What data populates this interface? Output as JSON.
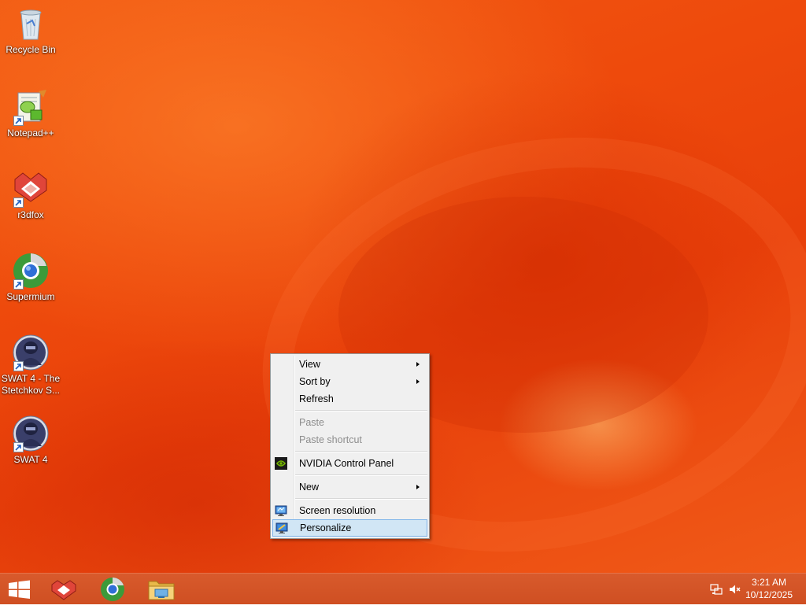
{
  "desktop": {
    "icons": [
      {
        "label": "Recycle Bin",
        "icon": "recycle-bin-icon"
      },
      {
        "label": "Notepad++",
        "icon": "notepad-plus-plus-icon"
      },
      {
        "label": "r3dfox",
        "icon": "r3dfox-icon"
      },
      {
        "label": "Supermium",
        "icon": "supermium-icon"
      },
      {
        "label": "SWAT 4 - The Stetchkov S...",
        "icon": "swat4-stetchkov-icon"
      },
      {
        "label": "SWAT 4",
        "icon": "swat4-icon"
      }
    ]
  },
  "context_menu": {
    "items": {
      "view": "View",
      "sort_by": "Sort by",
      "refresh": "Refresh",
      "paste": "Paste",
      "paste_shortcut": "Paste shortcut",
      "nvidia": "NVIDIA Control Panel",
      "new": "New",
      "screen_resolution": "Screen resolution",
      "personalize": "Personalize"
    },
    "highlighted": "Personalize"
  },
  "taskbar": {
    "start": "windows-start-icon",
    "pinned": [
      "r3dfox-icon",
      "supermium-icon",
      "file-explorer-icon"
    ],
    "tray": {
      "network": "network-icon",
      "volume": "volume-muted-icon",
      "time": "3:21 AM",
      "date": "10/12/2025"
    }
  },
  "colors": {
    "wallpaper": "#ee4a0c",
    "taskbar": "#d25224",
    "menu_bg": "#f0f0f0",
    "menu_highlight": "#d1e6f5",
    "menu_highlight_border": "#7eb4ea"
  }
}
